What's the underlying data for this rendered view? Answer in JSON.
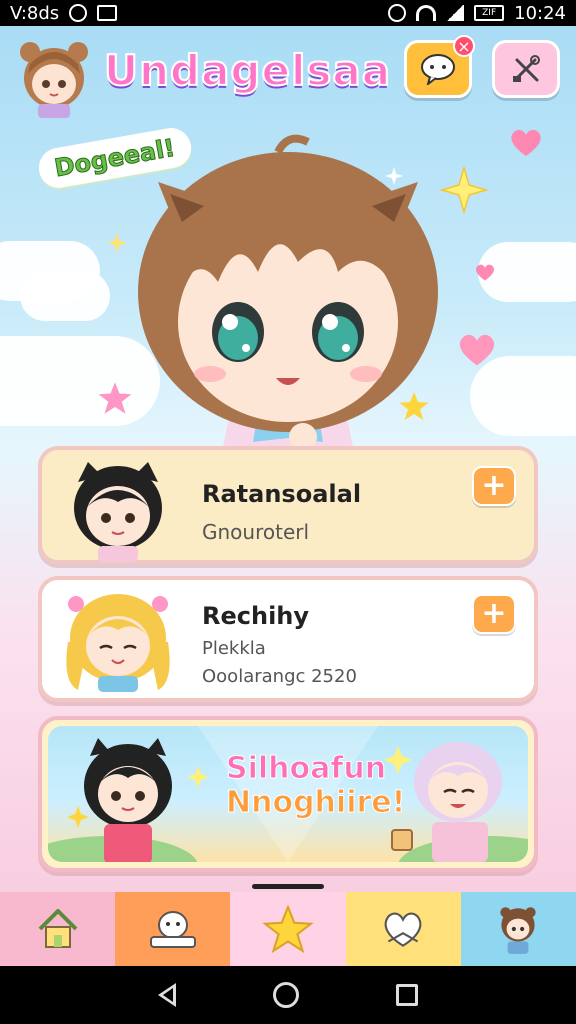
{
  "status_bar": {
    "carrier": "V:8ds",
    "time": "10:24",
    "battery_label": "ZIF"
  },
  "header": {
    "title": "Undagelsaa",
    "notification_badge": "×"
  },
  "speech_bubble": "Dogeeal!",
  "cards": [
    {
      "title": "Ratansoalal",
      "subtitle": "Gnouroterl"
    },
    {
      "title": "Rechihy",
      "subtitle": "Plekkla",
      "meta": "Ooolarangc 2520"
    }
  ],
  "banner": {
    "line1": "Silhoafun",
    "line2": "Nnoghiire!"
  },
  "tabs": [
    {
      "icon": "home-icon"
    },
    {
      "icon": "mascot-icon"
    },
    {
      "icon": "star-icon"
    },
    {
      "icon": "heart-bow-icon"
    },
    {
      "icon": "character-icon"
    }
  ],
  "colors": {
    "title_pink": "#ff76c8",
    "chat_button": "#ffbf3a",
    "settings_button": "#ffc6df",
    "plus_button": "#ffa94d",
    "tab_home": "#f8b9cf",
    "tab_mascot": "#ff9e59",
    "tab_star": "#ffd3e5",
    "tab_heart": "#ffe07a",
    "tab_character": "#8fd6f0"
  }
}
